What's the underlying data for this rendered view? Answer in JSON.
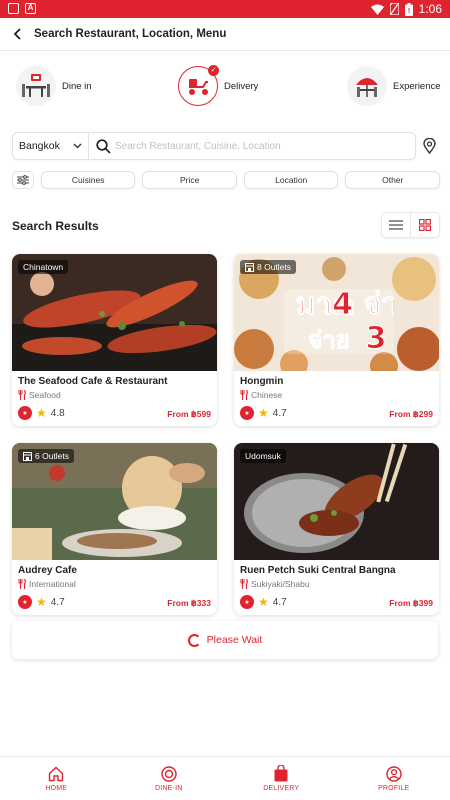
{
  "statusbar": {
    "time": "1:06"
  },
  "header": {
    "title": "Search Restaurant, Location, Menu"
  },
  "modes": [
    {
      "label": "Dine in",
      "icon": "dine-in-icon"
    },
    {
      "label": "Delivery",
      "icon": "delivery-scooter-icon",
      "selected": true
    },
    {
      "label": "Experience",
      "icon": "experience-icon"
    }
  ],
  "search": {
    "city": "Bangkok",
    "placeholder": "Search Restaurant, Cuisine, Location"
  },
  "filters": [
    "Cuisines",
    "Price",
    "Location",
    "Other"
  ],
  "results": {
    "title": "Search Results",
    "cards": [
      {
        "tag": "Chinatown",
        "name": "The Seafood Cafe & Restaurant",
        "cuisine": "Seafood",
        "rating": "4.8",
        "price": "From ฿599"
      },
      {
        "tag": "8 Outlets",
        "name": "Hongmin",
        "cuisine": "Chinese",
        "rating": "4.7",
        "price": "From ฿299",
        "image_text": "มา4 จ่าย3"
      },
      {
        "tag": "6 Outlets",
        "name": "Audrey Cafe",
        "cuisine": "International",
        "rating": "4.7",
        "price": "From ฿333"
      },
      {
        "tag": "Udomsuk",
        "name": "Ruen Petch Suki Central Bangna",
        "cuisine": "Sukiyaki/Shabu",
        "rating": "4.7",
        "price": "From ฿399"
      }
    ]
  },
  "loading": {
    "text": "Please Wait"
  },
  "bottomnav": [
    {
      "label": "HOME",
      "icon": "home-icon"
    },
    {
      "label": "DINE-IN",
      "icon": "dine-in-nav-icon"
    },
    {
      "label": "DELIVERY",
      "icon": "delivery-bag-icon"
    },
    {
      "label": "PROFILE",
      "icon": "profile-icon"
    }
  ],
  "colors": {
    "accent": "#e0242f"
  }
}
